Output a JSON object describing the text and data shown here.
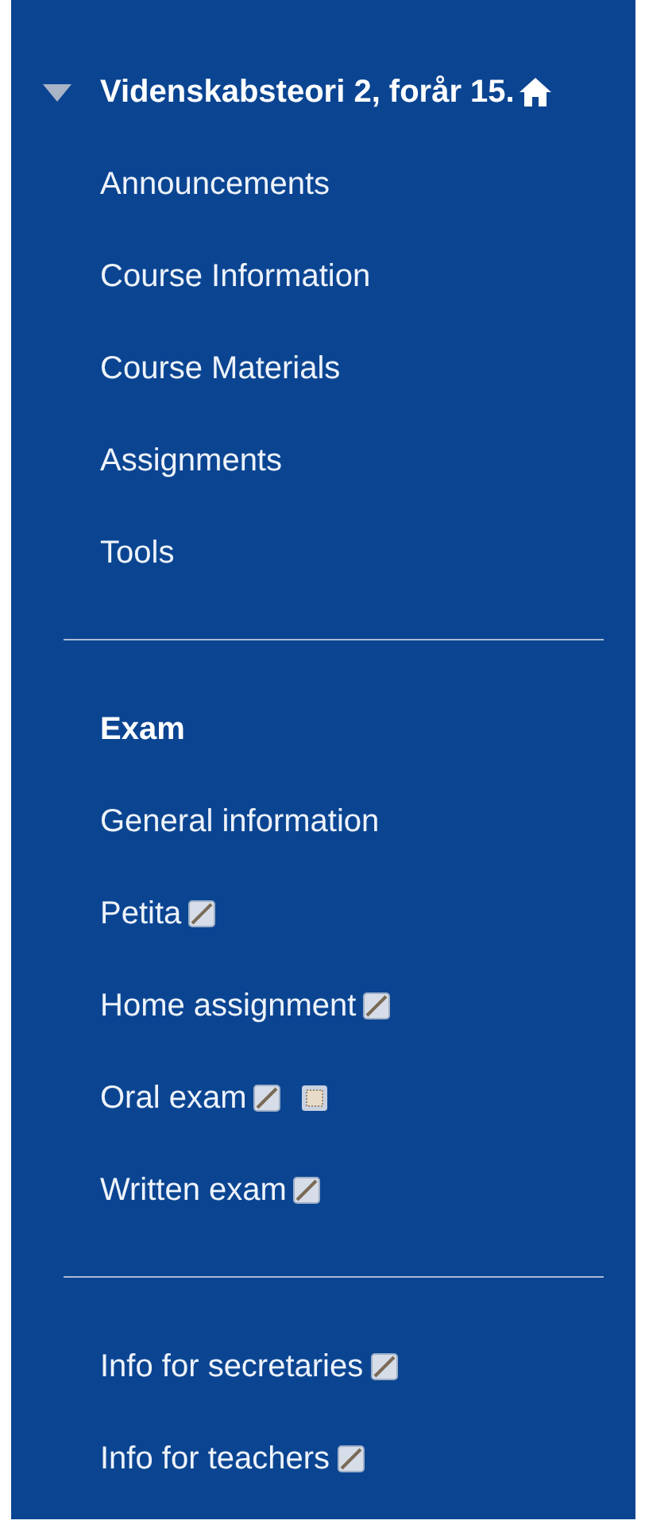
{
  "course": {
    "title": "Videnskabsteori 2, forår 15.",
    "expanded": true
  },
  "groups": [
    {
      "items": [
        {
          "label": "Announcements"
        },
        {
          "label": "Course Information"
        },
        {
          "label": "Course Materials"
        },
        {
          "label": "Assignments"
        },
        {
          "label": "Tools"
        }
      ]
    },
    {
      "heading": "Exam",
      "items": [
        {
          "label": "General information"
        },
        {
          "label": "Petita",
          "icons": [
            {
              "kind": "hidden"
            }
          ]
        },
        {
          "label": "Home assignment",
          "icons": [
            {
              "kind": "hidden"
            }
          ]
        },
        {
          "label": "Oral exam",
          "icons": [
            {
              "kind": "hidden"
            },
            {
              "kind": "release"
            }
          ]
        },
        {
          "label": "Written exam",
          "icons": [
            {
              "kind": "hidden"
            }
          ]
        }
      ]
    },
    {
      "items": [
        {
          "label": "Info for secretaries",
          "icons": [
            {
              "kind": "hidden"
            }
          ]
        },
        {
          "label": "Info for teachers",
          "icons": [
            {
              "kind": "hidden"
            }
          ]
        }
      ]
    }
  ]
}
